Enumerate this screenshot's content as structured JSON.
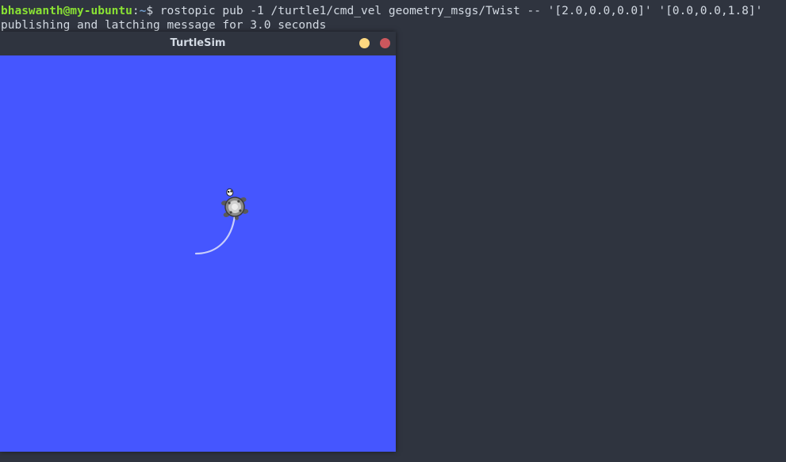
{
  "terminal": {
    "prompt_user": "bhaswanth@my-ubuntu",
    "prompt_sep": ":",
    "prompt_path": "~",
    "prompt_symbol": "$",
    "command": " rostopic pub -1 /turtle1/cmd_vel geometry_msgs/Twist -- '[2.0,0.0,0.0]' '[0.0,0.0,1.8]'",
    "output_line": "publishing and latching message for 3.0 seconds"
  },
  "window": {
    "title": "TurtleSim"
  },
  "colors": {
    "terminal_bg": "#2f343f",
    "prompt_user": "#8ae234",
    "canvas_bg": "#4556ff",
    "minimize": "#fdd880",
    "close": "#cc575d",
    "trail": "#c8cdfb"
  },
  "icons": {
    "minimize": "minimize-dot-icon",
    "close": "close-dot-icon",
    "turtle": "turtle-icon"
  }
}
